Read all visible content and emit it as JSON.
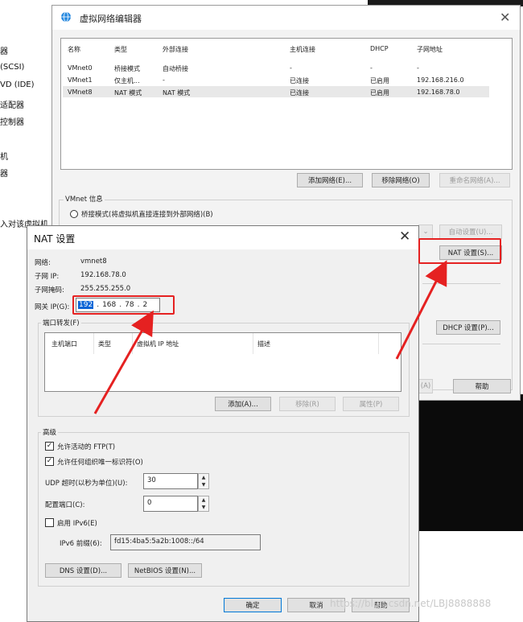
{
  "background": {
    "items": [
      "器",
      "(SCSI)",
      "VD (IDE)",
      "适配器",
      "控制器",
      "机",
      "器",
      "入对该虚拟机"
    ]
  },
  "vne": {
    "title": "虚拟网络编辑器",
    "columns": [
      "名称",
      "类型",
      "外部连接",
      "主机连接",
      "DHCP",
      "子网地址"
    ],
    "rows": [
      [
        "VMnet0",
        "桥接模式",
        "自动桥接",
        "-",
        "-",
        "-"
      ],
      [
        "VMnet1",
        "仅主机...",
        "-",
        "已连接",
        "已启用",
        "192.168.216.0"
      ],
      [
        "VMnet8",
        "NAT 模式",
        "NAT 模式",
        "已连接",
        "已启用",
        "192.168.78.0"
      ]
    ],
    "add_network": "添加网络(E)...",
    "remove_network": "移除网络(O)",
    "rename_network": "重命名网络(A)...",
    "info_legend": "VMnet 信息",
    "bridge_radio": "桥接模式(将虚拟机直接连接到外部网络)(B)",
    "auto_settings": "自动设置(U)...",
    "nat_settings": "NAT 设置(S)...",
    "dhcp_settings": "DHCP 设置(P)...",
    "apply": "(A)",
    "help": "帮助"
  },
  "nat": {
    "title": "NAT 设置",
    "network_label": "网络:",
    "network_value": "vmnet8",
    "subnet_ip_label": "子网 IP:",
    "subnet_ip_value": "192.168.78.0",
    "subnet_mask_label": "子网掩码:",
    "subnet_mask_value": "255.255.255.0",
    "gateway_label": "网关 IP(G):",
    "gateway_octets": [
      "192",
      "168",
      "78",
      "2"
    ],
    "port_forwarding_label": "端口转发(F)",
    "fwd_columns": [
      "主机端口",
      "类型",
      "虚拟机 IP 地址",
      "描述"
    ],
    "fwd_add": "添加(A)...",
    "fwd_remove": "移除(R)",
    "fwd_properties": "属性(P)",
    "advanced_label": "高级",
    "allow_ftp": "允许活动的 FTP(T)",
    "allow_oui": "允许任何组织唯一标识符(O)",
    "udp_timeout_label": "UDP 超时(以秒为单位)(U):",
    "udp_timeout_value": "30",
    "config_port_label": "配置端口(C):",
    "config_port_value": "0",
    "enable_ipv6": "启用 IPv6(E)",
    "ipv6_prefix_label": "IPv6 前缀(6):",
    "ipv6_prefix_value": "fd15:4ba5:5a2b:1008::/64",
    "dns_settings": "DNS 设置(D)...",
    "netbios_settings": "NetBIOS 设置(N)...",
    "ok": "确定",
    "cancel": "取消",
    "help": "帮助"
  },
  "watermark": "https://blog.csdn.net/LBJ8888888",
  "colors": {
    "highlight": "#e52121",
    "selection": "#0a64d6"
  }
}
